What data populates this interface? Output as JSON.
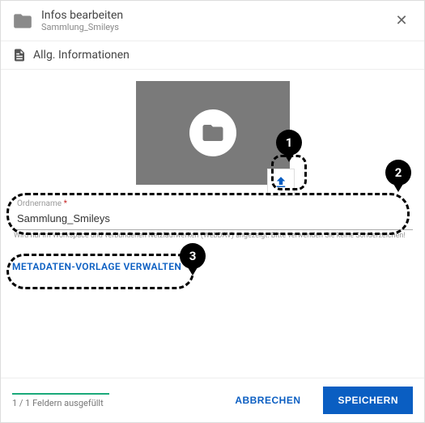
{
  "header": {
    "title": "Infos bearbeiten",
    "subtitle": "Sammlung_Smileys"
  },
  "section": {
    "title": "Allg. Informationen"
  },
  "form": {
    "folder_name_label": "Ordnername",
    "required_mark": "*",
    "folder_name_value": "Sammlung_Smileys",
    "folder_name_hint": "Wird nur im Workspace und verbundenen Netzlaufwerken (WebDAV) angezeigt. Bitte verwenden Sie keine Sonderzeichen!",
    "manage_template_label": "METADATEN-VORLAGE VERWALTEN"
  },
  "annotations": {
    "b1": "1",
    "b2": "2",
    "b3": "3"
  },
  "footer": {
    "progress_text": "1 / 1 Feldern ausgefüllt",
    "cancel_label": "ABBRECHEN",
    "save_label": "SPEICHERN"
  }
}
